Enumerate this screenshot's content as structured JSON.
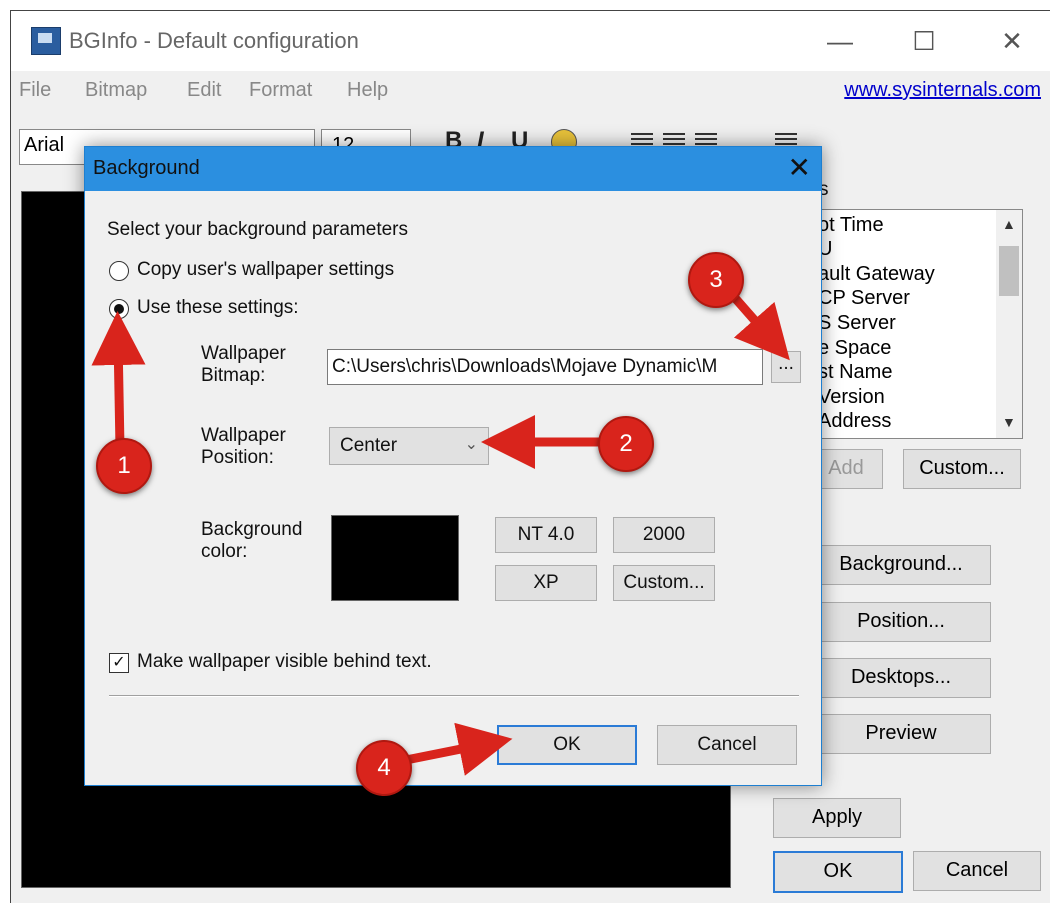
{
  "window": {
    "title": "BGInfo - Default configuration",
    "minimize_glyph": "—",
    "maximize_glyph": "☐",
    "close_glyph": "✕"
  },
  "menu": {
    "items": [
      "File",
      "Bitmap",
      "Edit",
      "Format",
      "Help"
    ],
    "link": "www.sysinternals.com"
  },
  "toolbar": {
    "font": "Arial",
    "size": "12",
    "bold": "B",
    "italic": "I",
    "underline": "U"
  },
  "fields": {
    "header_fragment": "s",
    "items": [
      "ot Time",
      "U",
      "ault Gateway",
      "CP Server",
      "S Server",
      "e Space",
      "st Name",
      "Version",
      "Address"
    ],
    "add": "Add",
    "custom": "Custom..."
  },
  "right_buttons": {
    "background": "Background...",
    "position": "Position...",
    "desktops": "Desktops...",
    "preview": "Preview",
    "apply": "Apply",
    "ok": "OK",
    "cancel": "Cancel"
  },
  "dialog": {
    "title": "Background",
    "close_glyph": "✕",
    "prompt": "Select your background parameters",
    "radio_copy": "Copy user's wallpaper settings",
    "radio_use": "Use these settings:",
    "wallpaper_bitmap_label_1": "Wallpaper",
    "wallpaper_bitmap_label_2": "Bitmap:",
    "wallpaper_bitmap_value": "C:\\Users\\chris\\Downloads\\Mojave Dynamic\\M",
    "browse": "...",
    "wallpaper_position_label_1": "Wallpaper",
    "wallpaper_position_label_2": "Position:",
    "wallpaper_position_value": "Center",
    "background_color_label_1": "Background",
    "background_color_label_2": "color:",
    "background_color": "#000000",
    "nt40": "NT 4.0",
    "b2000": "2000",
    "xp": "XP",
    "custom": "Custom...",
    "checkbox_label": "Make wallpaper visible behind text.",
    "checkbox_checked": true,
    "ok": "OK",
    "cancel": "Cancel"
  },
  "annotations": {
    "badge_1": "1",
    "badge_2": "2",
    "badge_3": "3",
    "badge_4": "4",
    "color": "#d9241c"
  }
}
